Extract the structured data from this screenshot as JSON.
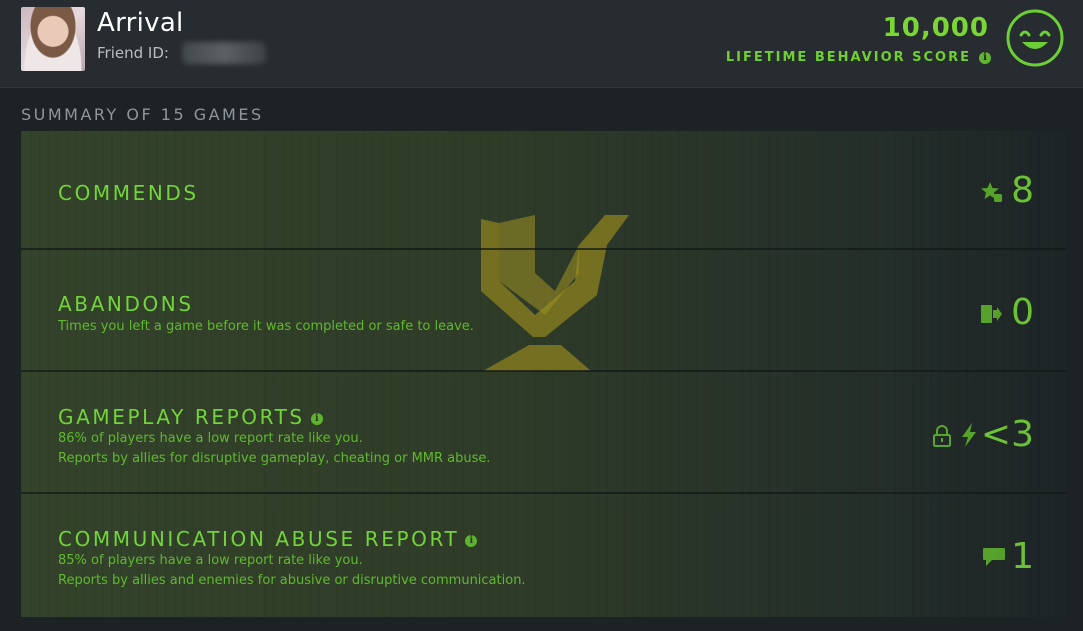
{
  "profile": {
    "name": "Arrival",
    "friend_id_label": "Friend ID:",
    "friend_id_value": "",
    "score_value": "10,000",
    "score_label": "LIFETIME BEHAVIOR SCORE"
  },
  "summary": {
    "title": "SUMMARY OF 15 GAMES"
  },
  "cards": [
    {
      "title": "COMMENDS",
      "value": "8",
      "icon": "star-thumb-icon"
    },
    {
      "title": "ABANDONS",
      "desc1": "Times you left a game before it was completed or safe to leave.",
      "value": "0",
      "icon": "exit-door-icon"
    },
    {
      "title": "GAMEPLAY REPORTS",
      "desc1": "86% of players have a low report rate like you.",
      "desc2": "Reports by allies for disruptive gameplay, cheating or MMR abuse.",
      "value": "<3",
      "icon": "lightning-icon"
    },
    {
      "title": "COMMUNICATION ABUSE REPORT",
      "desc1": "85% of players have a low report rate like you.",
      "desc2": "Reports by allies and enemies for abusive or disruptive communication.",
      "value": "1",
      "icon": "chat-bubble-icon"
    }
  ],
  "colors": {
    "accent_green": "#76d43a",
    "header_bg": "#262c30",
    "page_bg": "#1d2225",
    "emblem_gold": "#a79a1e"
  }
}
